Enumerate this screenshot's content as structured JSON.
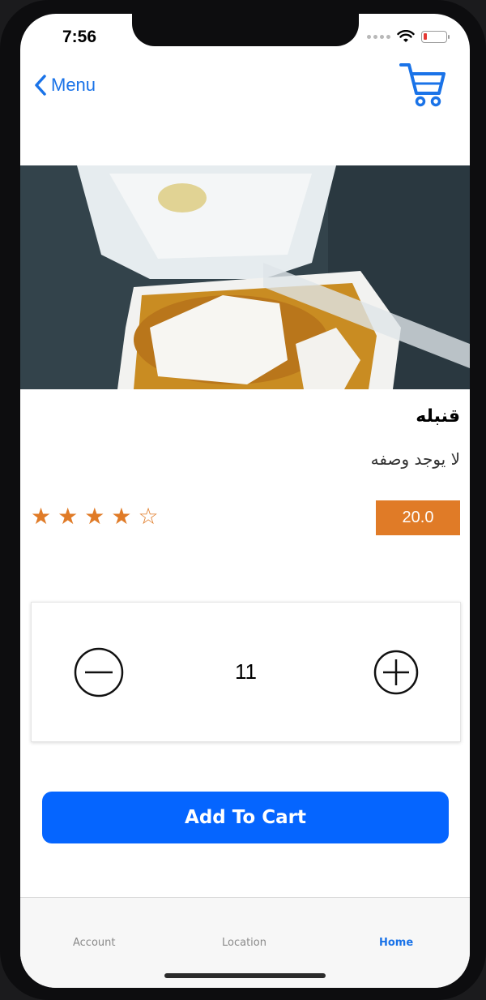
{
  "status": {
    "time": "7:56"
  },
  "nav": {
    "back_label": "Menu"
  },
  "product": {
    "title": "قنبله",
    "description": "لا يوجد وصفه",
    "price": "20.0",
    "rating": 4,
    "rating_max": 5
  },
  "quantity": {
    "value": "11"
  },
  "actions": {
    "add_to_cart": "Add To Cart"
  },
  "tabs": [
    {
      "label": "Account"
    },
    {
      "label": "Location"
    },
    {
      "label": "Home"
    }
  ],
  "colors": {
    "accent": "#1a73e8",
    "primary_button": "#0565ff",
    "price": "#e07b27",
    "star": "#e07b27"
  },
  "icons": [
    "chevron-left-icon",
    "cart-icon",
    "minus-circle-icon",
    "plus-circle-icon",
    "star-icon",
    "wifi-icon",
    "battery-icon"
  ]
}
